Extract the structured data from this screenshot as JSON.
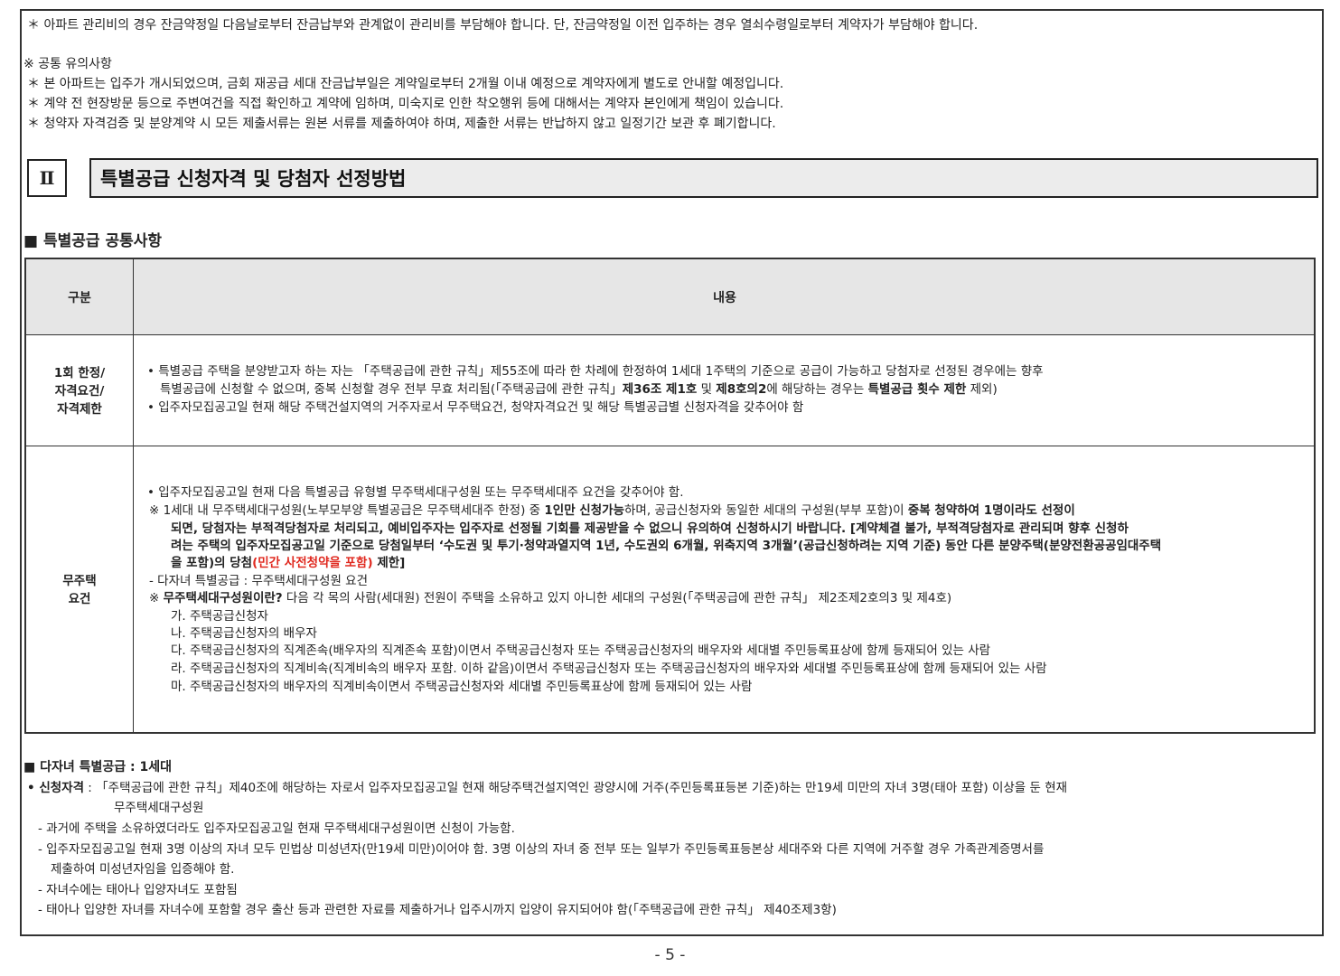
{
  "intro": {
    "line1": "＊ 아파트 관리비의 경우 잔금약정일 다음날로부터 잔금납부와 관계없이 관리비를 부담해야 합니다. 단, 잔금약정일 이전 입주하는 경우 열쇠수령일로부터 계약자가 부담해야 합니다.",
    "notice_title": "※ 공통 유의사항",
    "notice1": "＊ 본 아파트는 입주가 개시되었으며, 금회 재공급 세대 잔금납부일은 계약일로부터 2개월 이내 예정으로 계약자에게 별도로 안내할 예정입니다.",
    "notice2": "＊ 계약 전 현장방문 등으로 주변여건을 직접 확인하고 계약에 임하며, 미숙지로 인한 착오행위 등에 대해서는 계약자 본인에게 책임이 있습니다.",
    "notice3": "＊ 청약자 자격검증 및 분양계약 시 모든 제출서류는 원본 서류를 제출하여야 하며, 제출한 서류는 반납하지 않고 일정기간 보관 후 폐기합니다."
  },
  "section": {
    "number": "Ⅱ",
    "title": "특별공급 신청자격 및 당첨자 선정방법"
  },
  "subsection": {
    "title": "■ 특별공급 공통사항"
  },
  "table": {
    "headers": {
      "col1": "구분",
      "col2": "내용"
    },
    "row1": {
      "label_l1": "1회 한정/",
      "label_l2": "자격요건/",
      "label_l3": "자격제한",
      "t1a": "• 특별공급 주택을 분양받고자 하는 자는 「주택공급에 관한 규칙」제55조에 따라 한 차례에 한정하여 1세대 1주택의 기준으로 공급이 가능하고 당첨자로 선정된 경우에는 향후",
      "t1b_1": "특별공급에 신청할 수 없으며, 중복 신청할 경우 전부 무효 처리됨(「주택공급에 관한 규칙」",
      "t1b_2": "제36조 제1호",
      "t1b_3": " 및 ",
      "t1b_4": "제8호의2",
      "t1b_5": "에 해당하는 경우는 ",
      "t1b_6": "특별공급 횟수 제한",
      "t1b_7": " 제외)",
      "t2": "• 입주자모집공고일 현재 해당 주택건설지역의 거주자로서 무주택요건, 청약자격요건 및 해당 특별공급별 신청자격을 갖추어야 함"
    },
    "row2": {
      "label_l1": "무주택",
      "label_l2": "요건",
      "a": "• 입주자모집공고일 현재 다음 특별공급 유형별 무주택세대구성원 또는 무주택세대주 요건을 갖추어야 함.",
      "b_1": "※ 1세대 내 무주택세대구성원(노부모부양 특별공급은 무주택세대주 한정) 중 ",
      "b_2": "1인만 신청가능",
      "b_3": "하며, 공급신청자와 동일한 세대의 구성원(부부 포함)이 ",
      "b_4": "중복 청약하여 1명이라도 선정이",
      "c": "되면, 당첨자는 부적격당첨자로 처리되고, 예비입주자는 입주자로 선정될 기회를 제공받을 수 없으니 유의하여 신청하시기 바랍니다. [계약체결 불가, 부적격당첨자로 관리되며 향후 신청하",
      "d": "려는 주택의 입주자모집공고일 기준으로 당첨일부터 ‘수도권 및 투기·청약과열지역 1년, 수도권외 6개월, 위축지역 3개월’(공급신청하려는 지역 기준) 동안 다른 분양주택(분양전환공공임대주택",
      "e_1": "을 포함)의 당첨",
      "e_2": "(민간 사전청약을 포함)",
      "e_3": " 제한]",
      "f": "- 다자녀 특별공급 : 무주택세대구성원 요건",
      "g_1": "※ ",
      "g_2": "무주택세대구성원이란?",
      "g_3": " 다음 각 목의 사람(세대원) 전원이 주택을 소유하고 있지 아니한 세대의 구성원(「주택공급에 관한 규칙」 제2조제2호의3 및 제4호)",
      "h": "가. 주택공급신청자",
      "i": "나. 주택공급신청자의 배우자",
      "j": "다. 주택공급신청자의 직계존속(배우자의 직계존속 포함)이면서 주택공급신청자 또는 주택공급신청자의 배우자와 세대별 주민등록표상에 함께 등재되어 있는 사람",
      "k": "라. 주택공급신청자의 직계비속(직계비속의 배우자 포함. 이하 같음)이면서 주택공급신청자 또는 주택공급신청자의 배우자와 세대별 주민등록표상에 함께 등재되어 있는 사람",
      "l": "마. 주택공급신청자의 배우자의 직계비속이면서 주택공급신청자와 세대별 주민등록표상에 함께 등재되어 있는 사람"
    }
  },
  "multi_child": {
    "title": "■ 다자녀 특별공급 : 1세대",
    "q_label": "• 신청자격",
    "q_text": " : 「주택공급에 관한 규칙」제40조에 해당하는 자로서 입주자모집공고일 현재 해당주택건설지역인 광양시에 거주(주민등록표등본 기준)하는 만19세 미만의 자녀 3명(태아 포함) 이상을 둔 현재",
    "q_text2": "무주택세대구성원",
    "d1": "- 과거에 주택을 소유하였더라도 입주자모집공고일 현재 무주택세대구성원이면 신청이 가능함.",
    "d2": "- 입주자모집공고일 현재 3명 이상의 자녀 모두 민법상 미성년자(만19세 미만)이어야 함. 3명 이상의 자녀 중 전부 또는 일부가 주민등록표등본상 세대주와 다른 지역에 거주할 경우 가족관계증명서를",
    "d2b": "제출하여 미성년자임을 입증해야 함.",
    "d3": "- 자녀수에는 태아나 입양자녀도 포함됨",
    "d4": "- 태아나 입양한 자녀를 자녀수에 포함할 경우 출산 등과 관련한 자료를 제출하거나 입주시까지 입양이 유지되어야 함(「주택공급에 관한 규칙」 제40조제3항)"
  },
  "footer": {
    "page": "- 5 -"
  }
}
